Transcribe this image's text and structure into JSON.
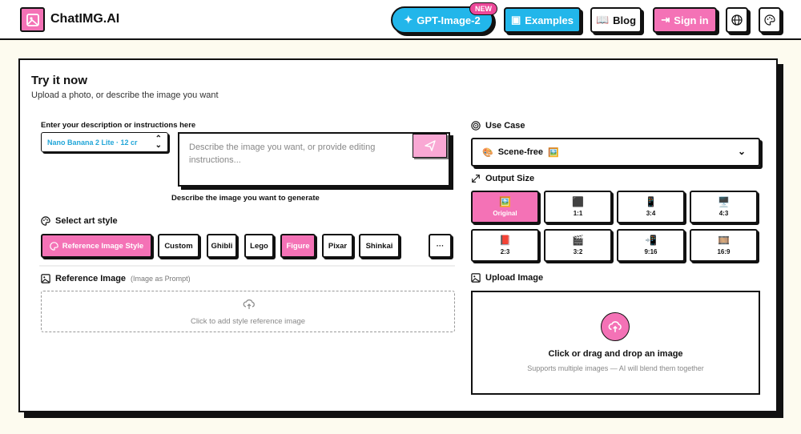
{
  "header": {
    "brand": "ChatIMG.AI",
    "gpt_button": "GPT-Image-2",
    "new_badge": "NEW",
    "examples_button": "Examples",
    "blog_button": "Blog",
    "signin_button": "Sign in",
    "colors": {
      "pink": "#f472b6",
      "blue": "#22b6ea",
      "badge": "#ec4899"
    }
  },
  "main": {
    "title": "Try it now",
    "subtitle": "Upload a photo, or describe the image you want",
    "description_label": "Enter your description or instructions here",
    "model_value": "Nano Banana 2 Lite · 12 cr",
    "prompt_placeholder": "Describe the image you want, or provide editing instructions...",
    "prompt_caption": "Describe the image you want to generate",
    "art_style_label": "Select art style",
    "styles": [
      "Reference Image Style",
      "Custom",
      "Ghibli",
      "Lego",
      "Figure",
      "Pixar",
      "Shinkai"
    ],
    "more_label": "···",
    "reference_label": "Reference Image",
    "reference_hint": "(Image as Prompt)",
    "reference_cta": "Click to add style reference image"
  },
  "right": {
    "use_case_label": "Use Case",
    "use_case_value": "Scene-free",
    "output_size_label": "Output Size",
    "sizes": [
      {
        "label": "Original",
        "icon": "🖼️",
        "selected": true
      },
      {
        "label": "1:1",
        "icon": "⬛"
      },
      {
        "label": "3:4",
        "icon": "📱"
      },
      {
        "label": "4:3",
        "icon": "🖥️"
      },
      {
        "label": "2:3",
        "icon": "📕"
      },
      {
        "label": "3:2",
        "icon": "🎬"
      },
      {
        "label": "9:16",
        "icon": "📲"
      },
      {
        "label": "16:9",
        "icon": "🎞️"
      }
    ],
    "upload_label": "Upload Image",
    "upload_title": "Click or drag and drop an image",
    "upload_sub": "Supports multiple images — AI will blend them together"
  }
}
